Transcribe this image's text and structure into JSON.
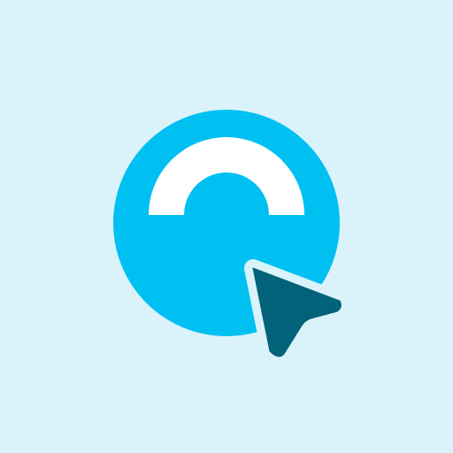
{
  "icon": {
    "name": "cursor-click-app-icon",
    "parts": [
      "circle-badge",
      "arch-symbol",
      "cursor-arrow"
    ]
  },
  "colors": {
    "background": "#daf3fa",
    "circle": "#00c0f2",
    "arch": "#ffffff",
    "cursor_fill": "#02627a",
    "cursor_outline": "#daf3fa"
  }
}
